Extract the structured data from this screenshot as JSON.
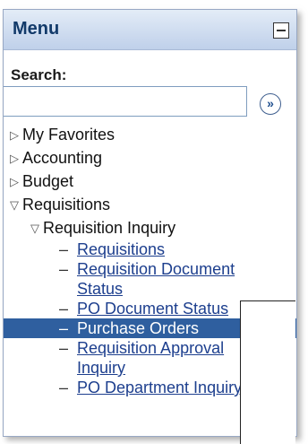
{
  "header": {
    "title": "Menu"
  },
  "search": {
    "label": "Search:",
    "value": "",
    "go_icon": "double-chevron-right-icon"
  },
  "nav": {
    "level0": [
      {
        "label": "My Favorites",
        "state": "collapsed"
      },
      {
        "label": "Accounting",
        "state": "collapsed"
      },
      {
        "label": "Budget",
        "state": "collapsed"
      },
      {
        "label": "Requisitions",
        "state": "expanded"
      }
    ],
    "level1": [
      {
        "label": "Requisition Inquiry",
        "state": "expanded"
      }
    ],
    "items": [
      {
        "label_lines": [
          "Requisitions"
        ]
      },
      {
        "label_lines": [
          "Requisition Document",
          "Status"
        ]
      },
      {
        "label_lines": [
          "PO Document Status"
        ]
      },
      {
        "label_lines": [
          "Purchase Orders"
        ],
        "selected": true
      },
      {
        "label_lines": [
          "Requisition Approval",
          "Inquiry"
        ]
      },
      {
        "label_lines": [
          "PO Department Inquiry"
        ]
      }
    ]
  },
  "colors": {
    "header_text": "#123a6a",
    "link": "#1d3f8e",
    "selected_bg": "#2f5f9f"
  }
}
